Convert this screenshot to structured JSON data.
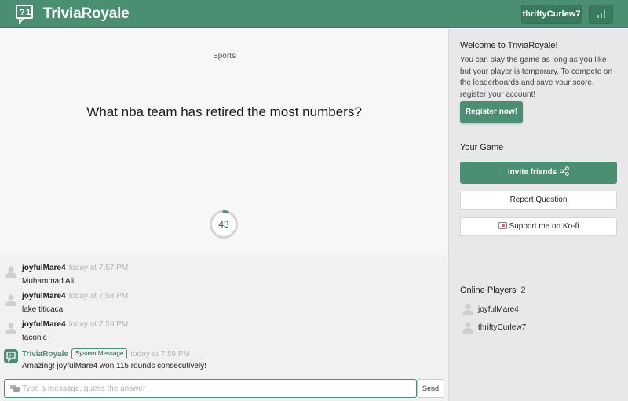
{
  "app": {
    "name": "TriviaRoyale"
  },
  "header": {
    "username": "thriftyCurlew7"
  },
  "game": {
    "category": "Sports",
    "question": "What nba team has retired the most numbers?",
    "timer": "43",
    "timer_progress": 0.05
  },
  "chat": {
    "messages": [
      {
        "user": "joyfulMare4",
        "time": "today at 7:57 PM",
        "text": "Muhammad Ali"
      },
      {
        "user": "joyfulMare4",
        "time": "today at 7:58 PM",
        "text": "lake titicaca"
      },
      {
        "user": "joyfulMare4",
        "time": "today at 7:59 PM",
        "text": "taconic"
      },
      {
        "user": "TriviaRoyale",
        "badge": "System Message",
        "time": "today at 7:59 PM",
        "text": "Amazing! joyfulMare4 won 115 rounds consecutively!"
      }
    ],
    "input_placeholder": "Type a message, guess the answer",
    "send_label": "Send"
  },
  "sidebar": {
    "welcome_title": "Welcome to TriviaRoyale!",
    "welcome_text": "You can play the game as long as you like but your player is temporary. To compete on the leaderboards and save your score, register your account!",
    "register_label": "Register now!",
    "your_game_title": "Your Game",
    "invite_label": "Invite friends",
    "report_label": "Report Question",
    "kofi_label": "Support me on Ko-fi",
    "online_title": "Online Players",
    "online_count": "2",
    "players": [
      "joyfulMare4",
      "thriftyCurlew7"
    ]
  },
  "colors": {
    "accent": "#4a8f72",
    "header": "#4a8f72",
    "sidebar_bg": "#e8e8ea"
  }
}
